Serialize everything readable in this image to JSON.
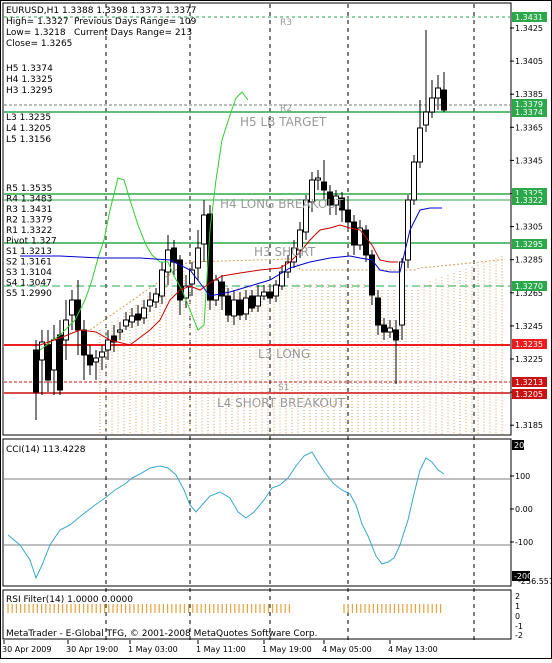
{
  "header": {
    "symbol": "EURUSD,H1  1.3388 1.3398 1.3373 1.3377",
    "high": "High= 1.3327",
    "prev_range": "Previous Days Range= 109",
    "low": "Low= 1.3218",
    "curr_range": "Current Days Range= 213",
    "close": "Close= 1.3265"
  },
  "levels_text": {
    "h": [
      "H5 1.3374",
      "H4 1.3325",
      "H3 1.3295"
    ],
    "l": [
      "L3 1.3235",
      "L4 1.3205",
      "L5 1.3156"
    ],
    "pivots": [
      "R5 1.3535",
      "R4 1.3483",
      "R3 1.3431",
      "R2 1.3379",
      "R1 1.3322",
      "Pivot 1.327",
      "S1 1.3213",
      "S2 1.3161",
      "S3 1.3104",
      "S4 1.3047",
      "S5 1.2990"
    ]
  },
  "price_axis": [
    "1.3425",
    "1.3405",
    "1.3385",
    "1.3365",
    "1.3345",
    "1.3325",
    "1.3305",
    "1.3285",
    "1.3265",
    "1.3245",
    "1.3225",
    "1.3205",
    "1.3185"
  ],
  "price_tags": [
    {
      "label": "1.3431",
      "color": "#2aa84a"
    },
    {
      "label": "1.3379",
      "color": "#2aa84a"
    },
    {
      "label": "1.3374",
      "color": "#2aa84a"
    },
    {
      "label": "1.3325",
      "color": "#2aa84a"
    },
    {
      "label": "1.3322",
      "color": "#2aa84a"
    },
    {
      "label": "1.3295",
      "color": "#2aa84a"
    },
    {
      "label": "1.3270",
      "color": "#2aa84a"
    },
    {
      "label": "1.3235",
      "color": "#ee1c1c"
    },
    {
      "label": "1.3213",
      "color": "#cc1111"
    },
    {
      "label": "1.3205",
      "color": "#cc1111"
    }
  ],
  "chart_labels": {
    "r3": "R3",
    "r2": "R2",
    "s1": "S1",
    "h5": "H5 LB TARGET",
    "h4": "H4 LONG BREAKOUT",
    "h3": "H3 SHORT",
    "l3": "L3 LONG",
    "l4": "L4 SHORT BREAKOUT"
  },
  "cci": {
    "title": "CCI(14) 113.4228",
    "axis": [
      "208.529",
      "100",
      "0.00",
      "-100",
      "-200",
      "-256.557"
    ]
  },
  "rsi": {
    "title": "RSI Filter(14) 1.0000 0.0000",
    "axis": [
      "2",
      "1",
      "0",
      "-1",
      "-2"
    ],
    "footer": "MetaTrader - E-Global TFG, © 2001-2008 MetaQuotes Software Corp."
  },
  "time_axis": [
    "30 Apr 2009",
    "30 Apr 19:00",
    "1 May 03:00",
    "1 May 11:00",
    "1 May 19:00",
    "4 May 05:00",
    "4 May 13:00"
  ],
  "colors": {
    "green_level": "#2aa84a",
    "red_level": "#ee1c1c",
    "dark_red_level": "#cc1111",
    "orange_dots": "#d99a55",
    "price_green_line": "#33cc33",
    "red_ma": "#cc0000",
    "blue_ma": "#0000cc",
    "cci_line": "#3aa6c9"
  }
}
